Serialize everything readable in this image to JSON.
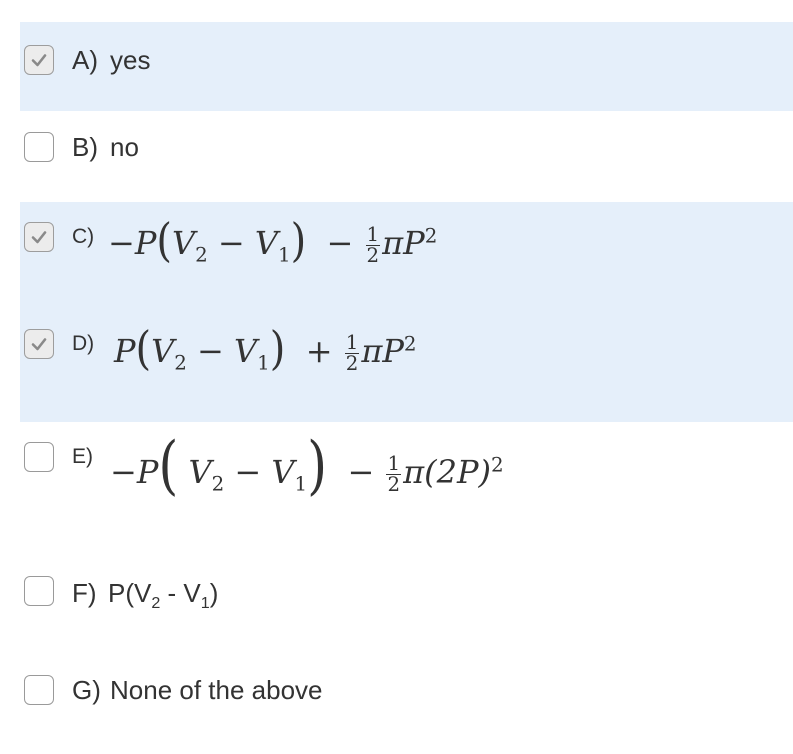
{
  "options": [
    {
      "letter": "A)",
      "text": "yes",
      "checked": true
    },
    {
      "letter": "B)",
      "text": "no",
      "checked": false
    },
    {
      "letter": "C)",
      "checked": true,
      "math": {
        "lead": "−",
        "var_p": "P",
        "v2": "V",
        "v2_sub": "2",
        "minus": "−",
        "v1": "V",
        "v1_sub": "1",
        "op": "−",
        "frac_num": "1",
        "frac_den": "2",
        "pi": "π",
        "tail": "P",
        "tail_sup": "2"
      }
    },
    {
      "letter": "D)",
      "checked": true,
      "math": {
        "lead": "",
        "var_p": "P",
        "v2": "V",
        "v2_sub": "2",
        "minus": "−",
        "v1": "V",
        "v1_sub": "1",
        "op": "+",
        "frac_num": "1",
        "frac_den": "2",
        "pi": "π",
        "tail": "P",
        "tail_sup": "2"
      }
    },
    {
      "letter": "E)",
      "checked": false,
      "math": {
        "lead": "−",
        "var_p": "P",
        "v2": "V",
        "v2_sub": "2",
        "minus": "−",
        "v1": "V",
        "v1_sub": "1",
        "op": "−",
        "frac_num": "1",
        "frac_den": "2",
        "pi": "π",
        "tail": "(2P)",
        "tail_sup": "2"
      }
    },
    {
      "letter": "F)",
      "checked": false,
      "text_pre": "P(V",
      "sub2": "2",
      "text_mid": " - V",
      "sub1": "1",
      "text_post": ")"
    },
    {
      "letter": "G)",
      "text": "None of the above",
      "checked": false
    }
  ],
  "colors": {
    "selected_bg": "#e5effa",
    "checkbox_border": "#9a9a9a",
    "check_mark": "#8a8a8a"
  }
}
